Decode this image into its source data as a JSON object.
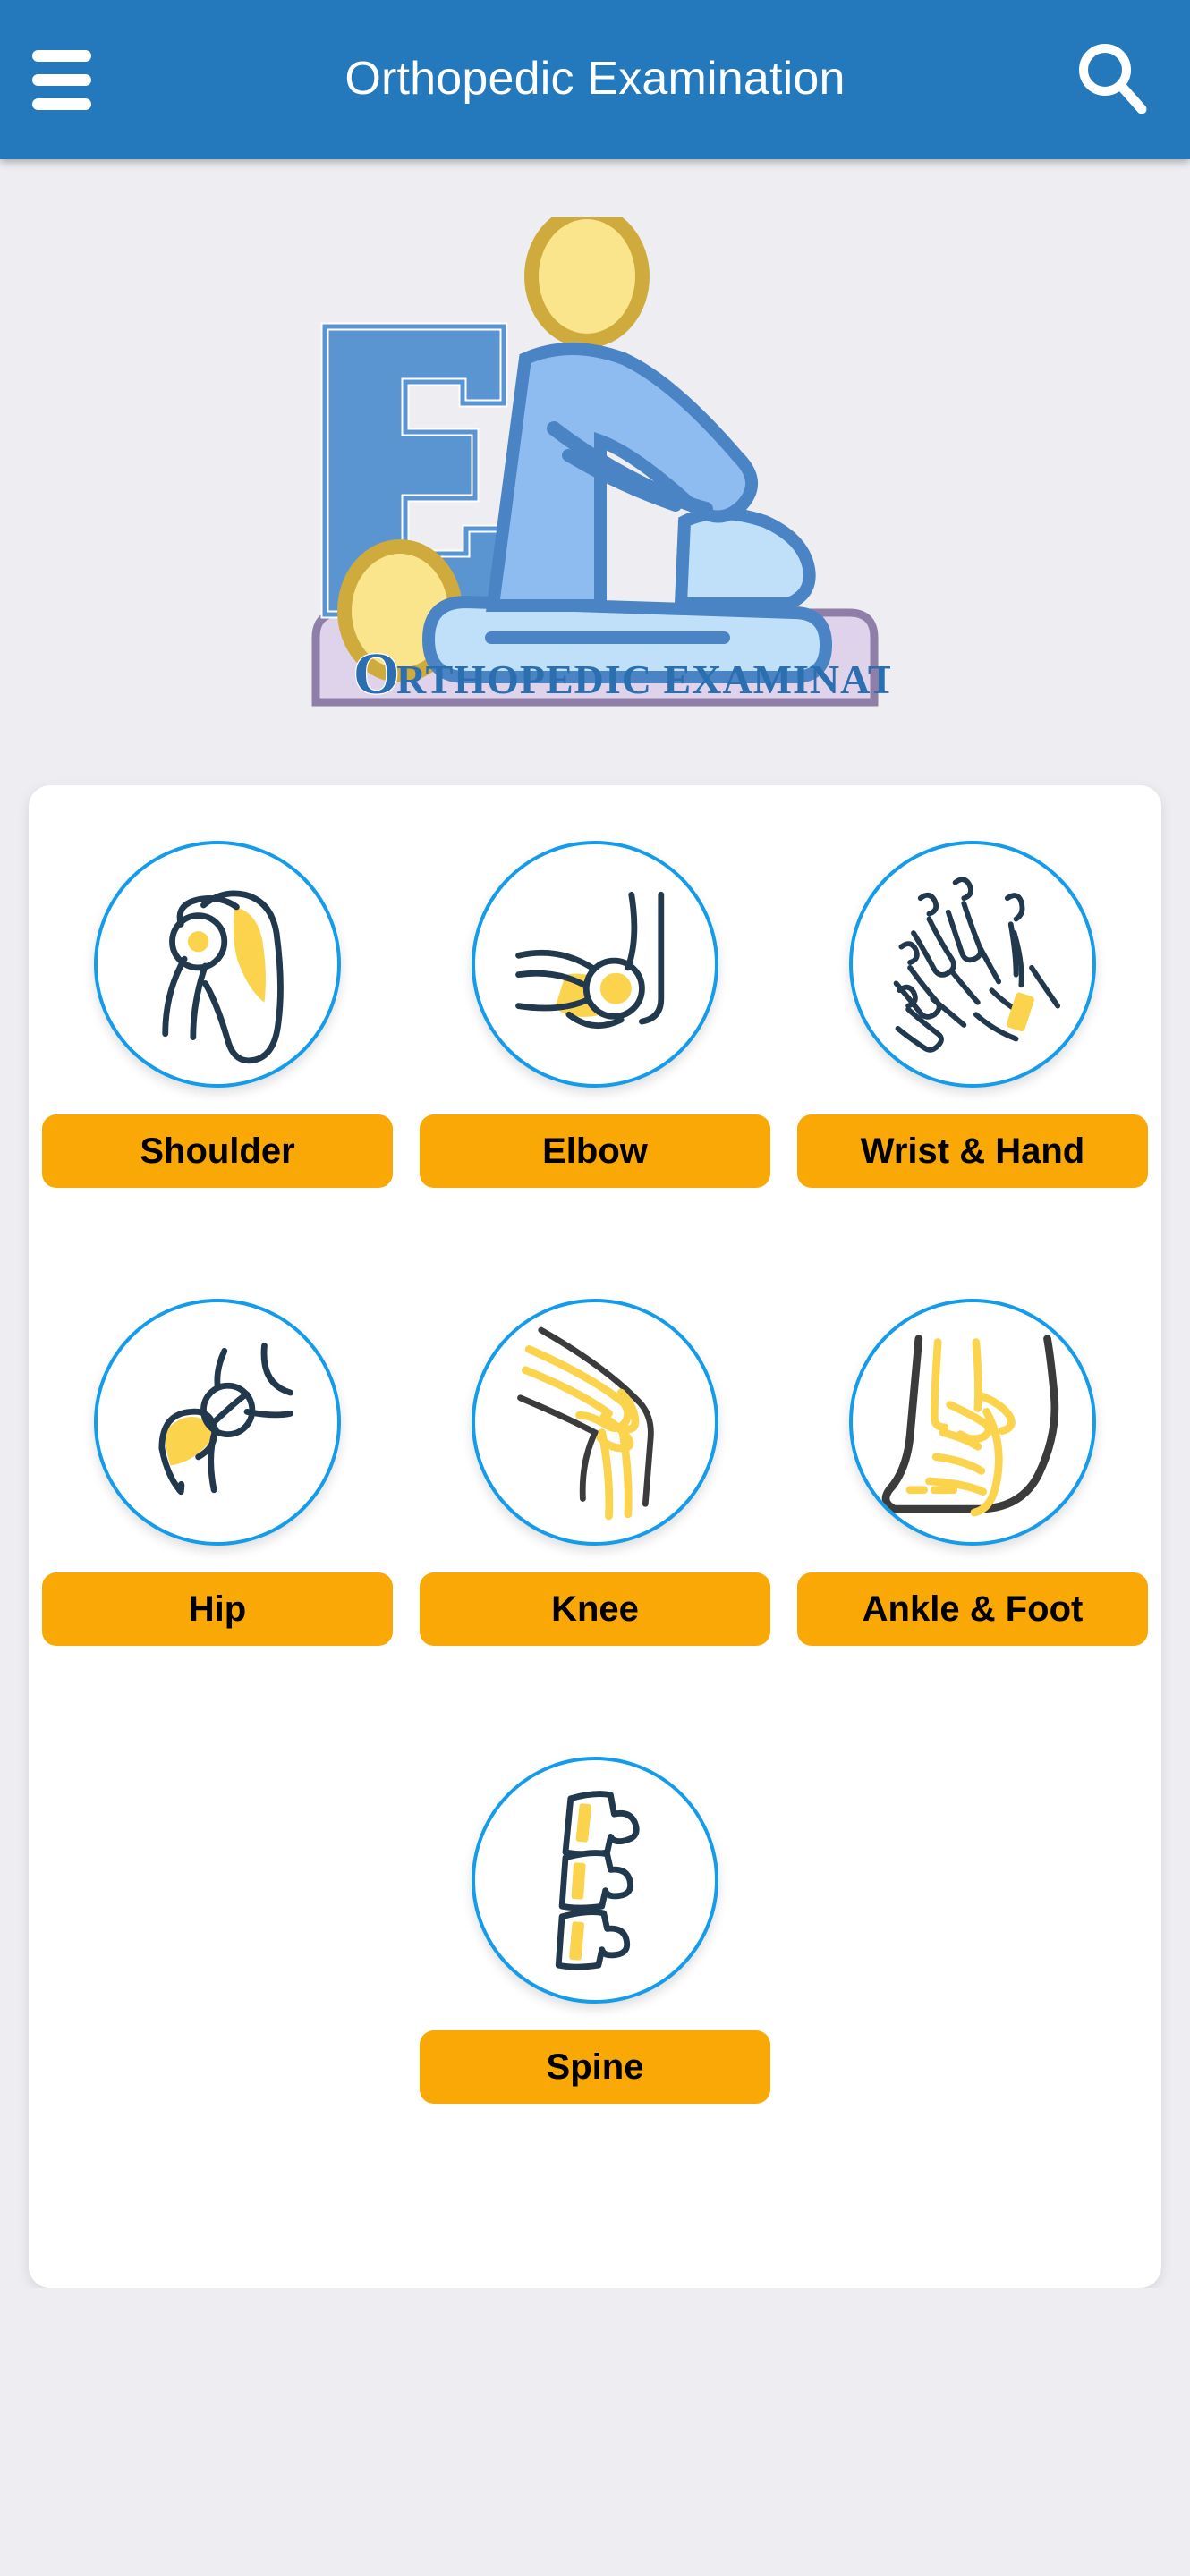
{
  "appbar": {
    "title": "Orthopedic Examination",
    "menu_icon": "hamburger-menu-icon",
    "search_icon": "search-icon",
    "background_color": "#2479bd",
    "title_color": "#ffffff"
  },
  "logo": {
    "letter_mark": "E",
    "banner_initial": "O",
    "banner_text": "RTHOPEDIC EXAMINATION",
    "alt": "Orthopedic Examination logo: examiner kneeling over a patient",
    "colors": {
      "letter_blue": "#5b95d1",
      "figure_blue": "#8ebcf0",
      "patient_blue": "#bfe0f8",
      "outline_blue": "#4a84c4",
      "head_yellow": "#fbe58c",
      "head_outline": "#ceab3c",
      "banner_fill": "#ded3ea",
      "banner_border": "#8f7fa8"
    }
  },
  "card": {
    "background_color": "#ffffff",
    "accent_ring": "#149ceb",
    "button_color": "#f9a806",
    "button_text_color": "#000000",
    "bone_outline": "#22384c",
    "bone_highlight": "#fbd34d"
  },
  "body_parts": [
    {
      "id": "shoulder",
      "label": "Shoulder",
      "icon": "shoulder-joint-icon",
      "row": 1,
      "col": 1
    },
    {
      "id": "elbow",
      "label": "Elbow",
      "icon": "elbow-joint-icon",
      "row": 1,
      "col": 2
    },
    {
      "id": "wrist-hand",
      "label": "Wrist & Hand",
      "icon": "hand-skeleton-icon",
      "row": 1,
      "col": 3
    },
    {
      "id": "hip",
      "label": "Hip",
      "icon": "hip-joint-icon",
      "row": 2,
      "col": 1
    },
    {
      "id": "knee",
      "label": "Knee",
      "icon": "knee-joint-icon",
      "row": 2,
      "col": 2
    },
    {
      "id": "ankle-foot",
      "label": "Ankle & Foot",
      "icon": "foot-skeleton-icon",
      "row": 2,
      "col": 3
    },
    {
      "id": "spine",
      "label": "Spine",
      "icon": "spine-vertebrae-icon",
      "row": 3,
      "col": 2
    }
  ],
  "page": {
    "background_color": "#eeeef2"
  }
}
